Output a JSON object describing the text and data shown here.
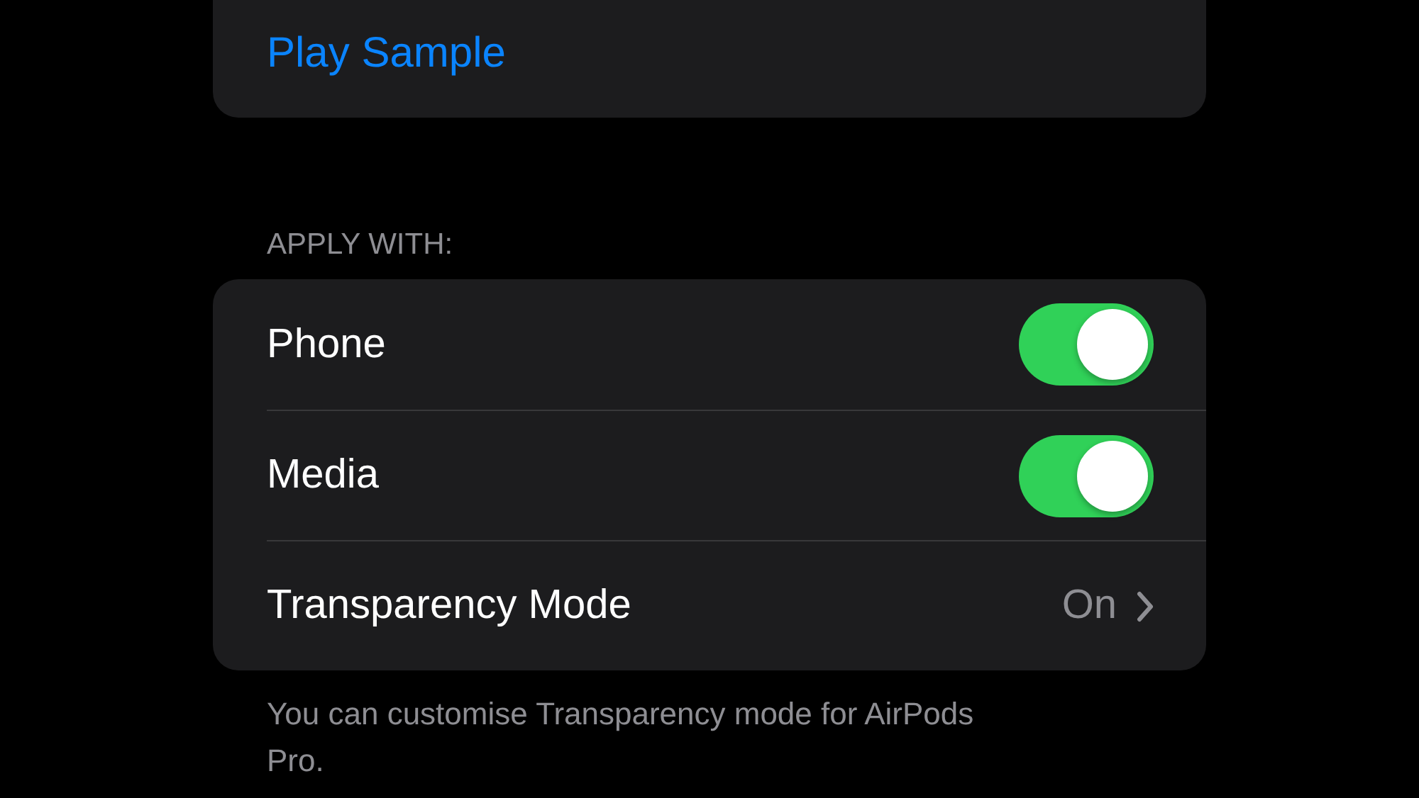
{
  "top_group": {
    "action": "Play Sample"
  },
  "section": {
    "header": "APPLY WITH:",
    "rows": [
      {
        "kind": "toggle",
        "label": "Phone",
        "on": true
      },
      {
        "kind": "toggle",
        "label": "Media",
        "on": true
      },
      {
        "kind": "disclosure",
        "label": "Transparency Mode",
        "value": "On"
      }
    ],
    "footer": "You can customise Transparency mode for AirPods Pro."
  }
}
